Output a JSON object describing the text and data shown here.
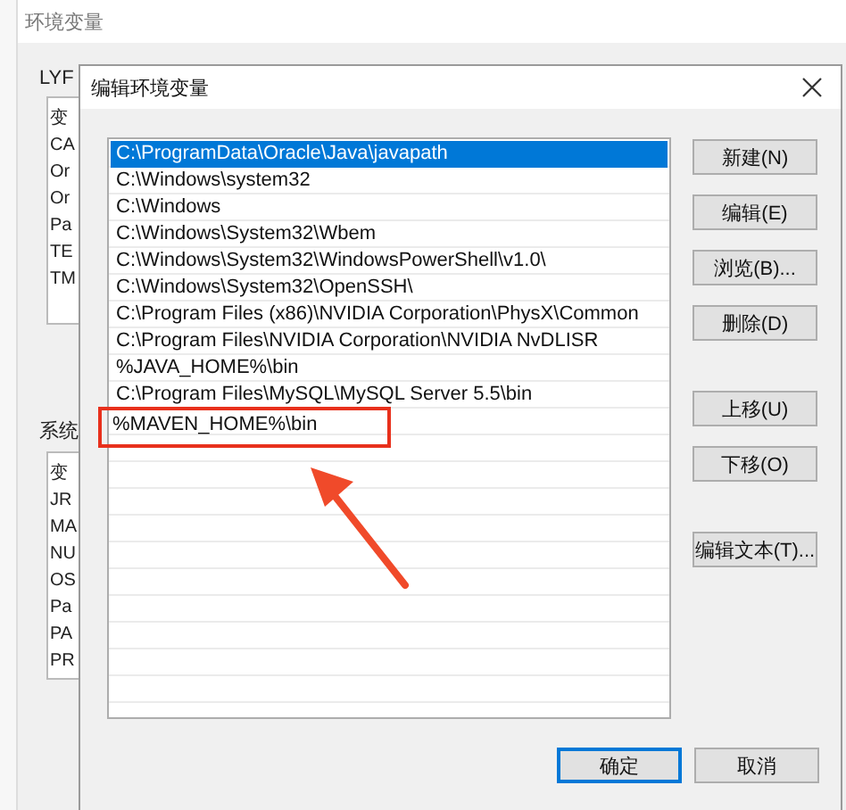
{
  "background_window": {
    "title": "环境变量",
    "user_group": {
      "label": "LYF",
      "rows": [
        "变",
        "CA",
        "Or",
        "Or",
        "Pa",
        "TE",
        "TM"
      ]
    },
    "system_group": {
      "label": "系统",
      "rows": [
        "变",
        "JR",
        "MA",
        "NU",
        "OS",
        "Pa",
        "PA",
        "PR"
      ]
    }
  },
  "dialog": {
    "title": "编辑环境变量",
    "paths": [
      {
        "text": "C:\\ProgramData\\Oracle\\Java\\javapath",
        "selected": true,
        "annotated": false
      },
      {
        "text": "C:\\Windows\\system32",
        "selected": false,
        "annotated": false
      },
      {
        "text": "C:\\Windows",
        "selected": false,
        "annotated": false
      },
      {
        "text": "C:\\Windows\\System32\\Wbem",
        "selected": false,
        "annotated": false
      },
      {
        "text": "C:\\Windows\\System32\\WindowsPowerShell\\v1.0\\",
        "selected": false,
        "annotated": false
      },
      {
        "text": "C:\\Windows\\System32\\OpenSSH\\",
        "selected": false,
        "annotated": false
      },
      {
        "text": "C:\\Program Files (x86)\\NVIDIA Corporation\\PhysX\\Common",
        "selected": false,
        "annotated": false
      },
      {
        "text": "C:\\Program Files\\NVIDIA Corporation\\NVIDIA NvDLISR",
        "selected": false,
        "annotated": false
      },
      {
        "text": "%JAVA_HOME%\\bin",
        "selected": false,
        "annotated": false
      },
      {
        "text": "C:\\Program Files\\MySQL\\MySQL Server 5.5\\bin",
        "selected": false,
        "annotated": false
      },
      {
        "text": "%MAVEN_HOME%\\bin",
        "selected": false,
        "annotated": true
      }
    ],
    "side_button_groups": [
      [
        "新建(N)",
        "编辑(E)",
        "浏览(B)...",
        "删除(D)"
      ],
      [
        "上移(U)",
        "下移(O)"
      ],
      [
        "编辑文本(T)..."
      ]
    ],
    "footer_buttons": [
      {
        "label": "确定",
        "default": true
      },
      {
        "label": "取消",
        "default": false
      }
    ]
  }
}
